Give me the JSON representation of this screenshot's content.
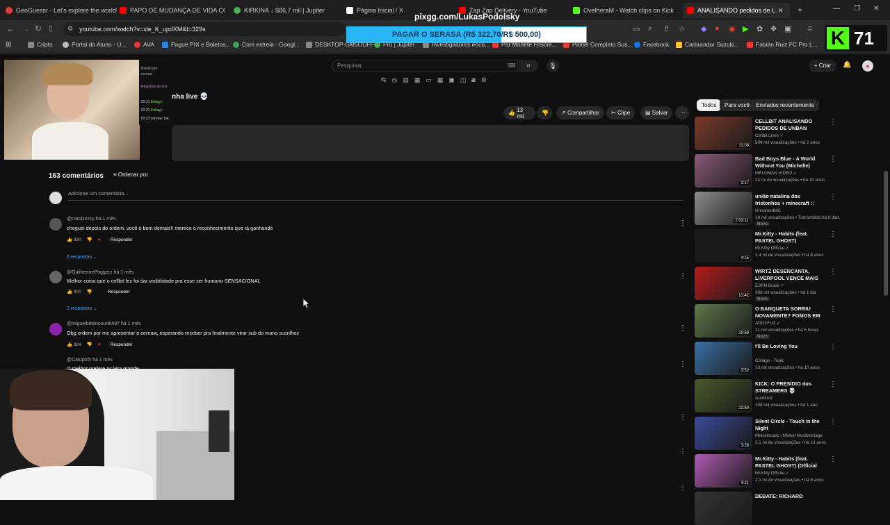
{
  "browser": {
    "tabs": [
      {
        "title": "GeoGuessr - Let's explore the world!",
        "color": "#e53935"
      },
      {
        "title": "PAPO DE MUDANÇA DE VIDA COM",
        "color": "#ff0000"
      },
      {
        "title": "KIRKINA ↓ $86,7 mil | Jupiter",
        "color": "#4caf50"
      },
      {
        "title": "Página Inicial / X",
        "color": "#ffffff"
      },
      {
        "title": "Zap Zap Delivery - YouTube",
        "color": "#ff0000"
      },
      {
        "title": "OvelheraM - Watch clips on Kick",
        "color": "#53fc18"
      },
      {
        "title": "ANALISANDO pedidos de U",
        "color": "#ff0000"
      }
    ],
    "url": "youtube.com/watch?v=xle_K_updXM&t=329s",
    "bookmarks": [
      {
        "label": "Cripto",
        "color": "#888"
      },
      {
        "label": "Portal do Aluno - U...",
        "color": "#bbb"
      },
      {
        "label": "AVA",
        "color": "#e53935"
      },
      {
        "label": "Pague PIX e Boletos...",
        "color": "#1e88e5"
      },
      {
        "label": "Com estreia - Googl...",
        "color": "#34a853"
      },
      {
        "label": "DESKTOP-GM5OUFF",
        "color": "#888"
      },
      {
        "label": "Pro | Jupiter",
        "color": "#4caf50"
      },
      {
        "label": "Investigadores enco...",
        "color": "#888"
      },
      {
        "label": "Par Manete Freio/e...",
        "color": "#e53935"
      },
      {
        "label": "Painel Completo Sus...",
        "color": "#e53935"
      },
      {
        "label": "Facebook",
        "color": "#1877f2"
      },
      {
        "label": "Carburador Suzuki...",
        "color": "#fbc02d"
      },
      {
        "label": "Fabián Ruiz FC Pro L...",
        "color": "#e53935"
      }
    ]
  },
  "overlay": {
    "pixgg": "pixgg.com/LukasPodolsky",
    "donation_bar": "PAGAR O SERASA (R$ 322,70/R$ 500,00)",
    "donation_progress": 0.6454,
    "kick_count": "71"
  },
  "youtube": {
    "search_placeholder": "Pesquisar",
    "create_label": "Criar",
    "video_title_tail": "nha live 💀",
    "actions": {
      "likes": "13 mil",
      "share": "Compartilhar",
      "clip": "Clipe",
      "save": "Salvar"
    },
    "chat_snippet": {
      "line1": "Baixito por",
      "line2": "cereaw",
      "highlight": "Registros de che",
      "rows": [
        {
          "time": "02:21",
          "user": "Enkayy:"
        },
        {
          "time": "02:22",
          "user": "Enkayy:"
        },
        {
          "time": "02:23",
          "user": "cereaw: bai"
        }
      ]
    },
    "comments_header": {
      "count": "163 comentários",
      "sort": "Ordenar por",
      "add_placeholder": "Adicione um comentário..."
    },
    "comments": [
      {
        "user": "@carolzzzzy",
        "time": "há 1 mês",
        "text": "cheguei depois do ordem, você é bom demais!! merece o reconhecimento que tá ganhando",
        "likes": "930",
        "reply": "Responder",
        "replies": "6 respostas",
        "avatar_color": "#555"
      },
      {
        "user": "@GuilhermePoggerz",
        "time": "há 1 mês",
        "text": "Melhor coisa que o cellbit fez foi dar visibilidade pra esse ser humano SENSACIONAL",
        "likes": "400",
        "reply": "Responder",
        "replies": "2 respostas",
        "avatar_color": "#666"
      },
      {
        "user": "@miguelbittencourt6487",
        "time": "há 1 mês",
        "text": "Obg ordem por me apresentar o cereaw, esperando receber pra finalmente virar sub do mano sucrilhoz",
        "likes": "384",
        "reply": "Responder",
        "replies": "",
        "avatar_color": "#8e24aa"
      },
      {
        "user": "@Catupirih",
        "time": "há 1 mês",
        "text": "O melhor prefere as lera grande",
        "likes": "",
        "reply": "",
        "replies": "",
        "avatar_color": "#444"
      }
    ],
    "filter_chips": [
      "Todos",
      "Para você",
      "Enviados recentemente"
    ],
    "recommendations": [
      {
        "title": "CELLBIT ANALISANDO PEDIDOS DE UNBAN",
        "channel": "Cellbit Lives ✓",
        "meta": "504 mil visualizações • há 2 anos",
        "duration": "11:08",
        "badge": "",
        "color": "#7a3a2a"
      },
      {
        "title": "Bad Boys Blue - A World Without You (Michelle) (Officia...",
        "channel": "MELOMAN VIDEO ✓",
        "meta": "24 mi de visualizações • há 10 anos",
        "duration": "3:17",
        "badge": "",
        "color": "#8a5a7a"
      },
      {
        "title": "união natalina dos tristonhos + minecraft :: live-chat",
        "channel": "UnnamedMC",
        "meta": "29 mil visualizações • Transmitido há 8 dias",
        "duration": "2:03:11",
        "badge": "Novo",
        "color": "#8d8d8d"
      },
      {
        "title": "Mr.Kitty - Habits (feat. PASTEL GHOST)",
        "channel": "Mr.Kitty Official ✓",
        "meta": "2,4 mi de visualizações • há 8 anos",
        "duration": "4:15",
        "badge": "",
        "color": "#1a1a1a"
      },
      {
        "title": "WIRTZ DESENCANTA, LIVERPOOL VENCE MAIS UM...",
        "channel": "ESPN Brasil ✓",
        "meta": "360 mil visualizações • há 1 dia",
        "duration": "10:42",
        "badge": "Novo",
        "color": "#b71c1c"
      },
      {
        "title": "O BANQUETA SORRIU NOVAMENTE? FOMOS EM ...",
        "channel": "ADOLFUZ ✓",
        "meta": "21 mil visualizações • há 6 horas",
        "duration": "25:59",
        "badge": "Novo",
        "color": "#5d7a4a"
      },
      {
        "title": "I'll Be Loving You",
        "channel": "Collage - Topic",
        "meta": "10 mil visualizações • há 10 anos",
        "duration": "3:52",
        "badge": "",
        "color": "#3a6ea5"
      },
      {
        "title": "KICK: O PRESÍDIO dos STREAMERS 💀",
        "channel": "sucrilhoz",
        "meta": "108 mil visualizações • há 1 ano",
        "duration": "22:50",
        "badge": "",
        "color": "#4a5a2a"
      },
      {
        "title": "Silent Circle - Touch in the Night",
        "channel": "Meiselmusic | Meisel Musikverlage",
        "meta": "2,1 mi de visualizações • há 13 anos",
        "duration": "3:26",
        "badge": "",
        "color": "#3a4a9a"
      },
      {
        "title": "Mr.Kitty - Habits (feat. PASTEL GHOST) (Official Video)",
        "channel": "Mr.Kitty Official ✓",
        "meta": "2,1 mi de visualizações • há 8 anos",
        "duration": "4:21",
        "badge": "",
        "color": "#b05ab0"
      },
      {
        "title": "DEBATE: RICHARD",
        "channel": "",
        "meta": "",
        "duration": "",
        "badge": "",
        "color": "#333"
      }
    ]
  },
  "colors": {
    "yt_bg": "#0f0f0f",
    "donation_bar": "#29b6f6",
    "kick_green": "#53fc18",
    "link_blue": "#3ea6ff"
  }
}
